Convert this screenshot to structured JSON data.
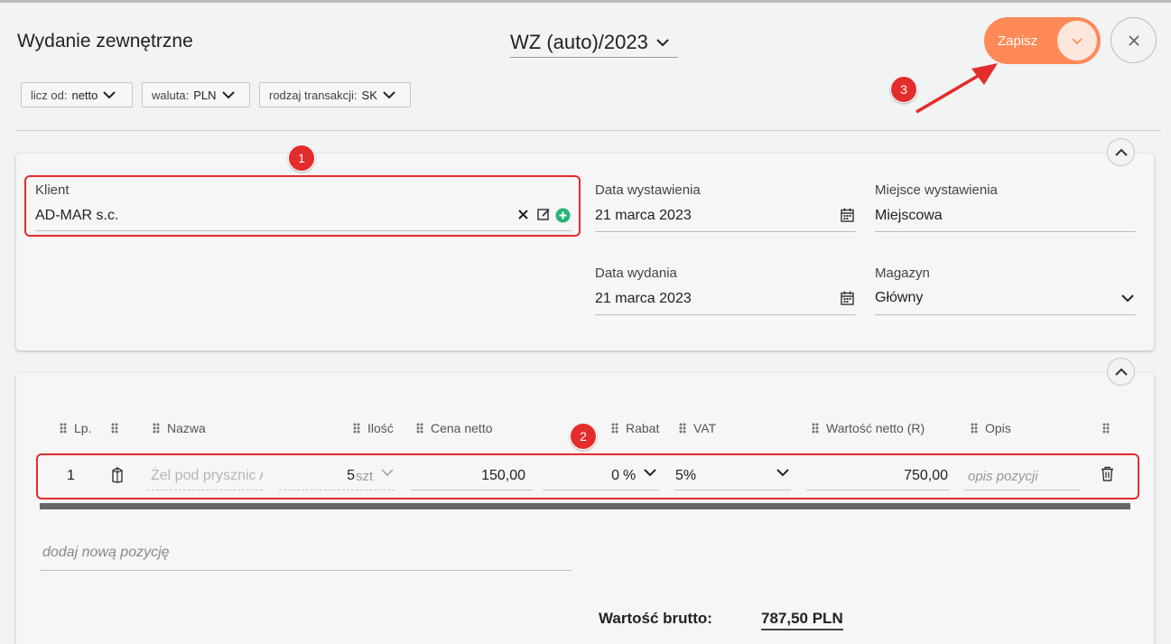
{
  "header": {
    "title": "Wydanie zewnętrzne",
    "doc_number": "WZ (auto)/2023",
    "save_label": "Zapisz"
  },
  "filters": [
    {
      "label": "licz od:",
      "value": "netto"
    },
    {
      "label": "waluta:",
      "value": "PLN"
    },
    {
      "label": "rodzaj transakcji:",
      "value": "SK"
    }
  ],
  "annotations": {
    "b1": "1",
    "b2": "2",
    "b3": "3"
  },
  "form": {
    "client_label": "Klient",
    "client_value": "AD-MAR s.c.",
    "issue_date_label": "Data wystawienia",
    "issue_date_value": "21 marca 2023",
    "place_label": "Miejsce wystawienia",
    "place_value": "Miejscowa",
    "release_date_label": "Data wydania",
    "release_date_value": "21 marca 2023",
    "warehouse_label": "Magazyn",
    "warehouse_value": "Główny"
  },
  "table": {
    "columns": {
      "lp": "Lp.",
      "name": "Nazwa",
      "qty": "Ilość",
      "net_price": "Cena netto",
      "discount": "Rabat",
      "vat": "VAT",
      "net_value": "Wartość netto (R)",
      "desc": "Opis"
    },
    "rows": [
      {
        "lp": "1",
        "name_placeholder": "Żel pod prysznic A",
        "qty": "5",
        "unit": "szt",
        "net_price": "150,00",
        "discount": "0",
        "discount_unit": "%",
        "vat": "5%",
        "net_value": "750,00",
        "desc_placeholder": "opis pozycji"
      }
    ],
    "add_row": "dodaj nową pozycję"
  },
  "summary": {
    "gross_label": "Wartość brutto:",
    "gross_value": "787,50 PLN"
  },
  "colors": {
    "accent": "#ff8a57",
    "annotation_red": "#e32c2c",
    "add_green": "#22b573"
  },
  "icons": [
    "chevron-down-icon",
    "close-icon",
    "clear-icon",
    "edit-icon",
    "add-circle-icon",
    "calendar-icon",
    "chevron-up-icon",
    "drag-handle-icon",
    "product-icon",
    "trash-icon"
  ]
}
